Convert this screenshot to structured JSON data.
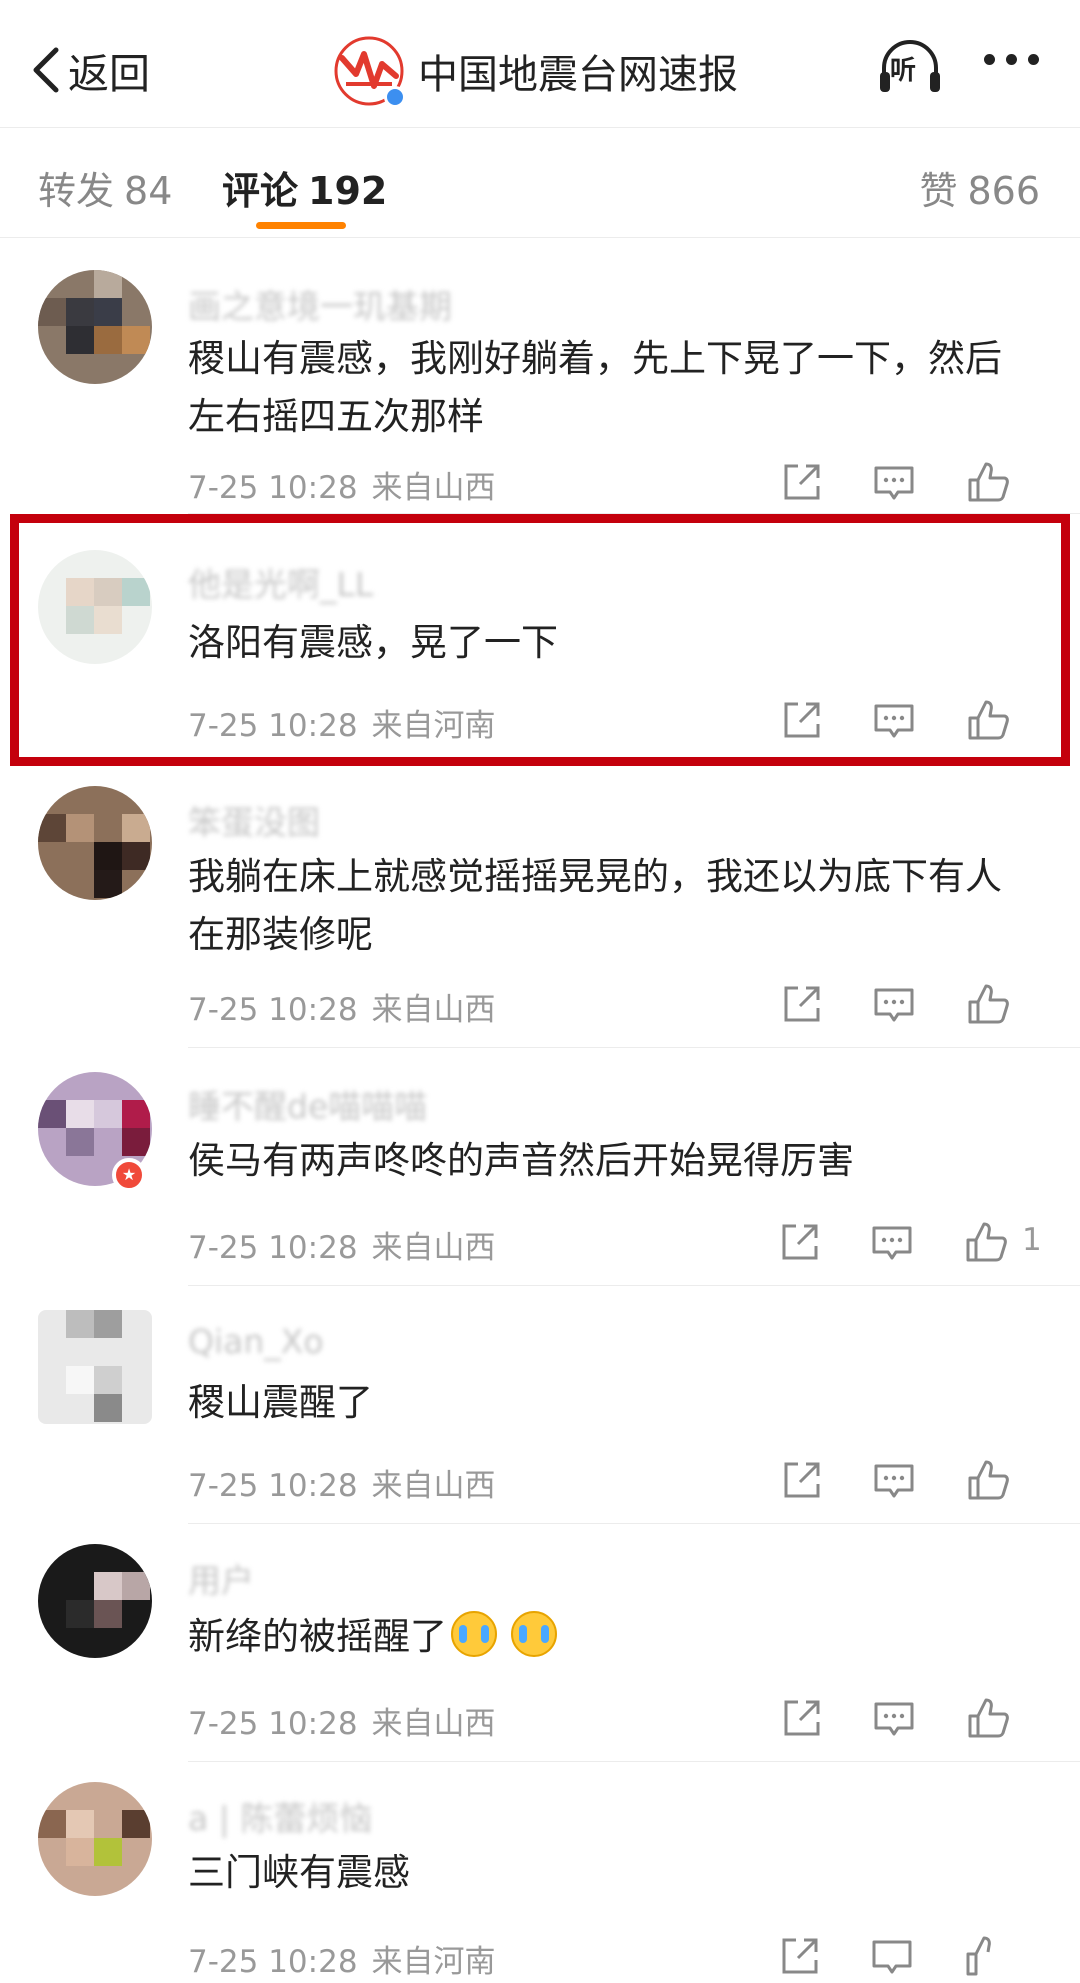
{
  "header": {
    "back_label": "返回",
    "title": "中国地震台网速报",
    "listen_label": "听"
  },
  "tabs": {
    "repost_label": "转发",
    "repost_count": "84",
    "comment_label": "评论",
    "comment_count": "192",
    "like_label": "赞",
    "like_count": "866"
  },
  "colors": {
    "accent": "#ff8200",
    "highlight_border": "#c4000c",
    "meta_text": "#999999"
  },
  "comments": [
    {
      "username": "画之意境一玑基期",
      "content": "稷山有震感，我刚好躺着，先上下晃了一下，然后左右摇四五次那样",
      "time": "7-25 10:28",
      "region": "来自山西",
      "likes": ""
    },
    {
      "username": "他是光啊_LL",
      "content": "洛阳有震感，晃了一下",
      "time": "7-25 10:28",
      "region": "来自河南",
      "likes": ""
    },
    {
      "username": "笨蛋没图",
      "content": "我躺在床上就感觉摇摇晃晃的，我还以为底下有人在那装修呢",
      "time": "7-25 10:28",
      "region": "来自山西",
      "likes": ""
    },
    {
      "username": "睡不醒de喵喵喵",
      "content": "侯马有两声咚咚的声音然后开始晃得厉害",
      "time": "7-25 10:28",
      "region": "来自山西",
      "likes": "1"
    },
    {
      "username": "Qian_Xo",
      "content": "稷山震醒了",
      "time": "7-25 10:28",
      "region": "来自山西",
      "likes": ""
    },
    {
      "username": "用户",
      "content": "新绛的被摇醒了",
      "time": "7-25 10:28",
      "region": "来自山西",
      "likes": ""
    },
    {
      "username": "a | 陈蕾烦恼",
      "content": "三门峡有震感",
      "time": "7-25 10:28",
      "region": "来自河南",
      "likes": ""
    }
  ]
}
